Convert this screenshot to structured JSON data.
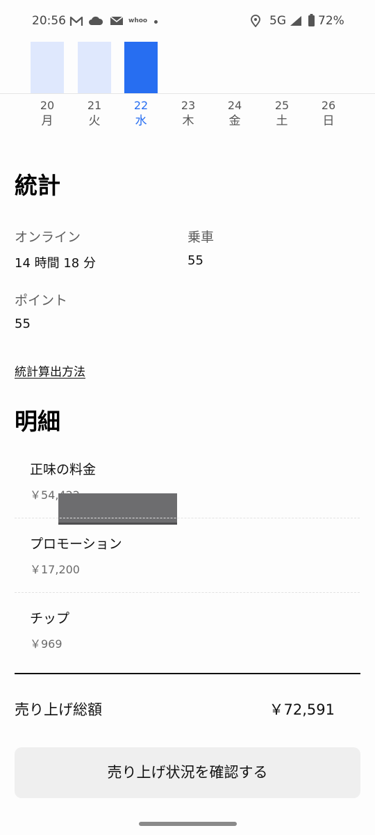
{
  "status_bar": {
    "time": "20:56",
    "app_text": "whoo",
    "network": "5G",
    "battery": "72%"
  },
  "chart_data": {
    "type": "bar",
    "categories": [
      "20",
      "21",
      "22",
      "23",
      "24",
      "25",
      "26"
    ],
    "weekdays": [
      "月",
      "火",
      "水",
      "木",
      "金",
      "土",
      "日"
    ],
    "selected_index": 2,
    "colors": {
      "selected": "#276ef1",
      "unselected": "#dfe8fd"
    }
  },
  "stats": {
    "title": "統計",
    "online_label": "オンライン",
    "online_value": "14 時間 18 分",
    "rides_label": "乗車",
    "rides_value": "55",
    "points_label": "ポイント",
    "points_value": "55",
    "method_link": "統計算出方法"
  },
  "breakdown": {
    "title": "明細",
    "items": [
      {
        "label": "正味の料金",
        "amount": "￥54,422"
      },
      {
        "label": "プロモーション",
        "amount": "￥17,200"
      },
      {
        "label": "チップ",
        "amount": "￥969"
      }
    ],
    "total_label": "売り上げ総額",
    "total_value": "￥72,591"
  },
  "button": {
    "label": "売り上げ状況を確認する"
  }
}
